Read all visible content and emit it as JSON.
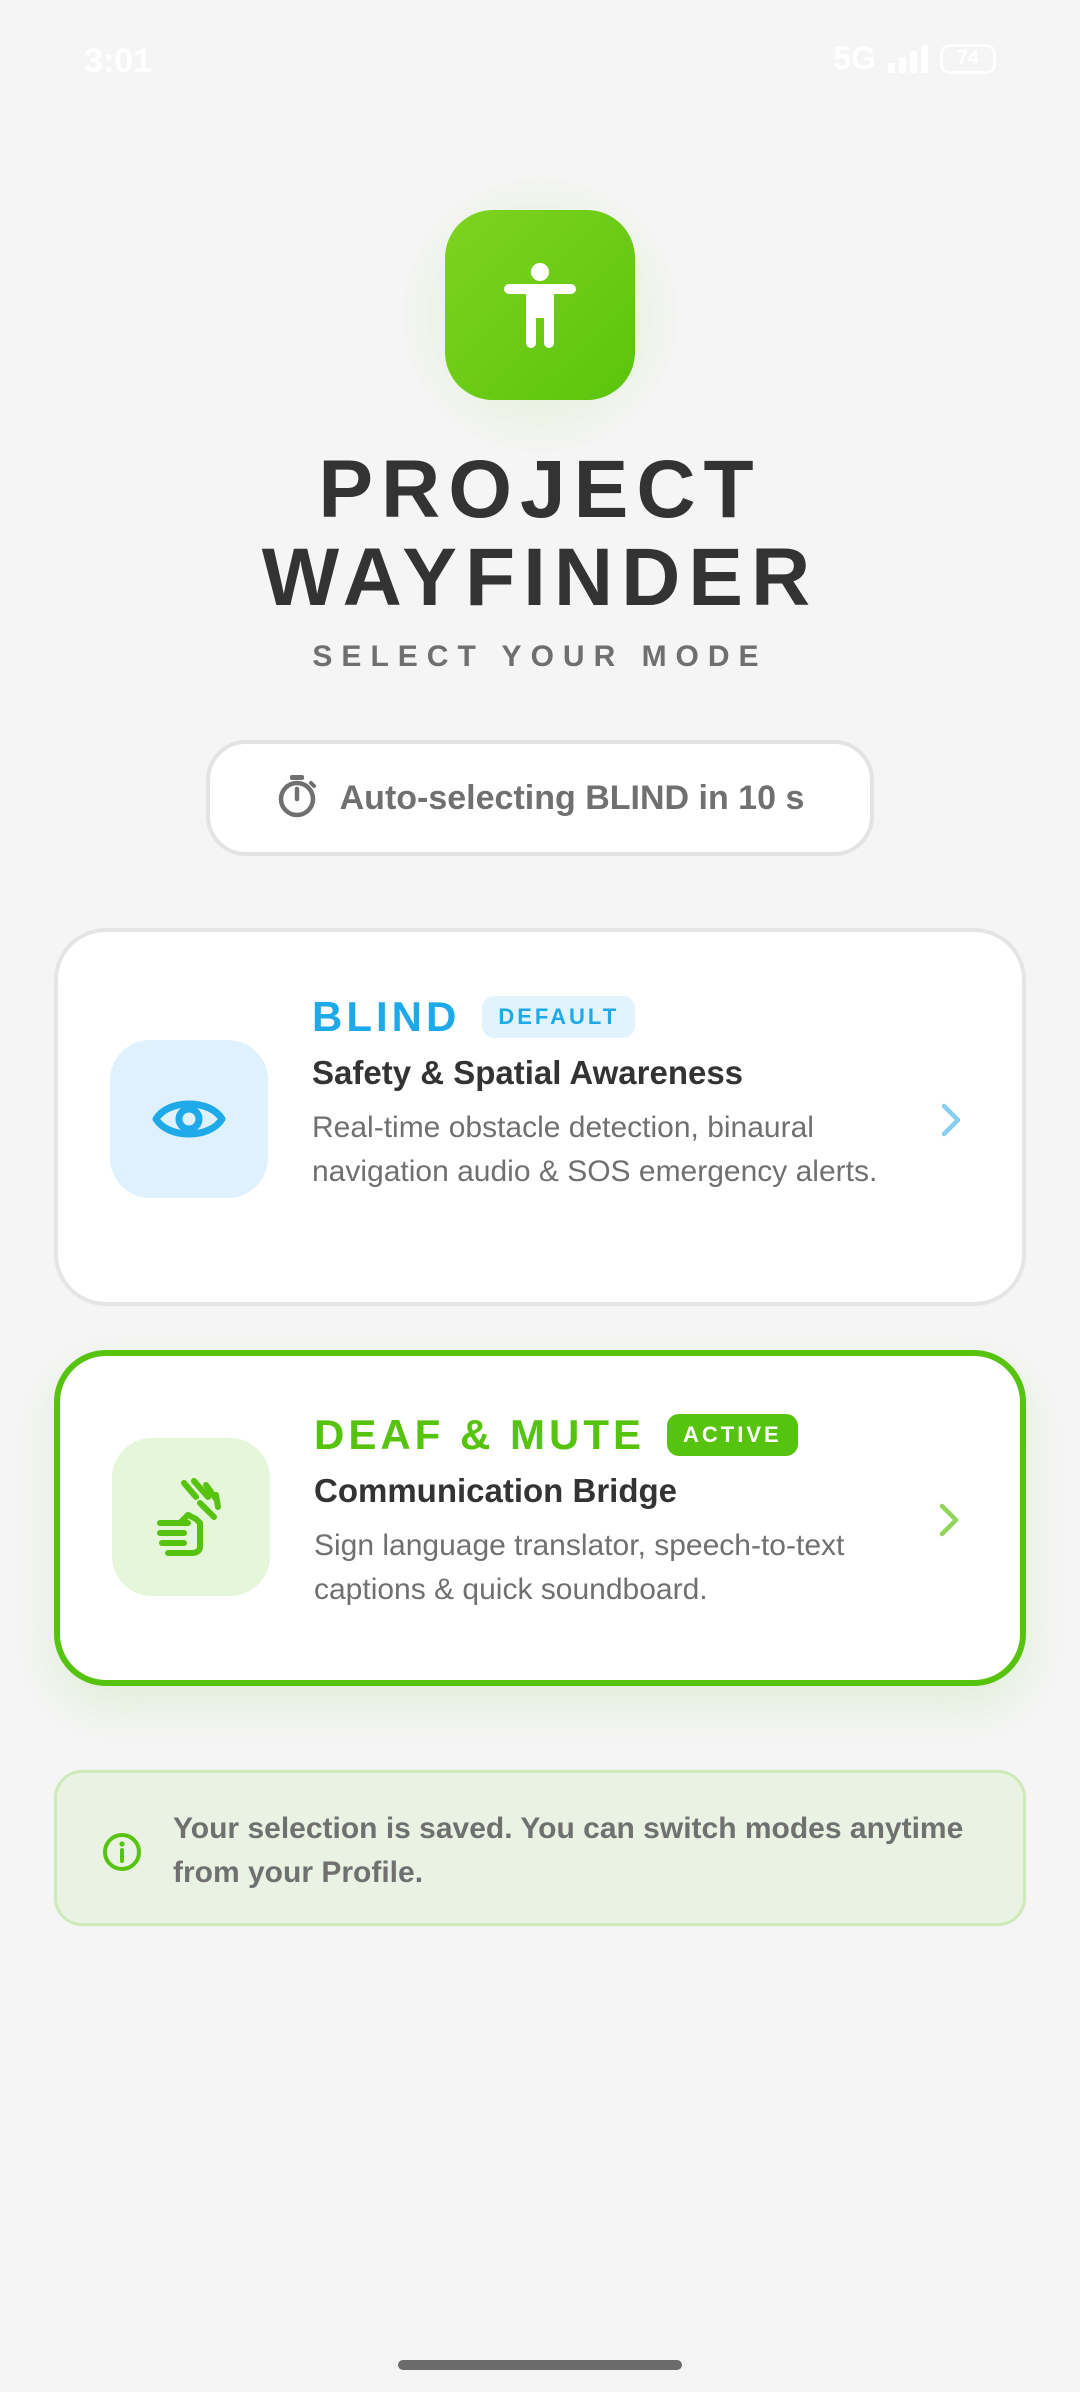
{
  "status_bar": {
    "time": "3:01",
    "network": "5G",
    "battery": "74",
    "icons": [
      "signal-icon",
      "battery-icon"
    ]
  },
  "app": {
    "icon": "accessibility-icon",
    "title_line1": "PROJECT",
    "title_line2": "WAYFINDER",
    "subtitle": "SELECT YOUR MODE"
  },
  "countdown": {
    "icon": "timer-icon",
    "text": "Auto-selecting BLIND in 10 s"
  },
  "modes": [
    {
      "id": "blind",
      "icon": "eye-icon",
      "name": "BLIND",
      "badge": "DEFAULT",
      "title": "Safety & Spatial Awareness",
      "description": "Real-time obstacle detection, binaural navigation audio & SOS emergency alerts.",
      "accent_color": "#1eaae8",
      "selected": false
    },
    {
      "id": "deaf-mute",
      "icon": "sign-language-icon",
      "name": "DEAF & MUTE",
      "badge": "ACTIVE",
      "title": "Communication Bridge",
      "description": "Sign language translator, speech-to-text captions & quick soundboard.",
      "accent_color": "#56c30f",
      "selected": true
    }
  ],
  "info": {
    "icon": "info-icon",
    "text": "Your selection is saved. You can switch modes anytime from your Profile."
  },
  "colors": {
    "brand_green": "#56c30f",
    "blind_blue": "#1eaae8",
    "background": "#f5f5f5"
  }
}
